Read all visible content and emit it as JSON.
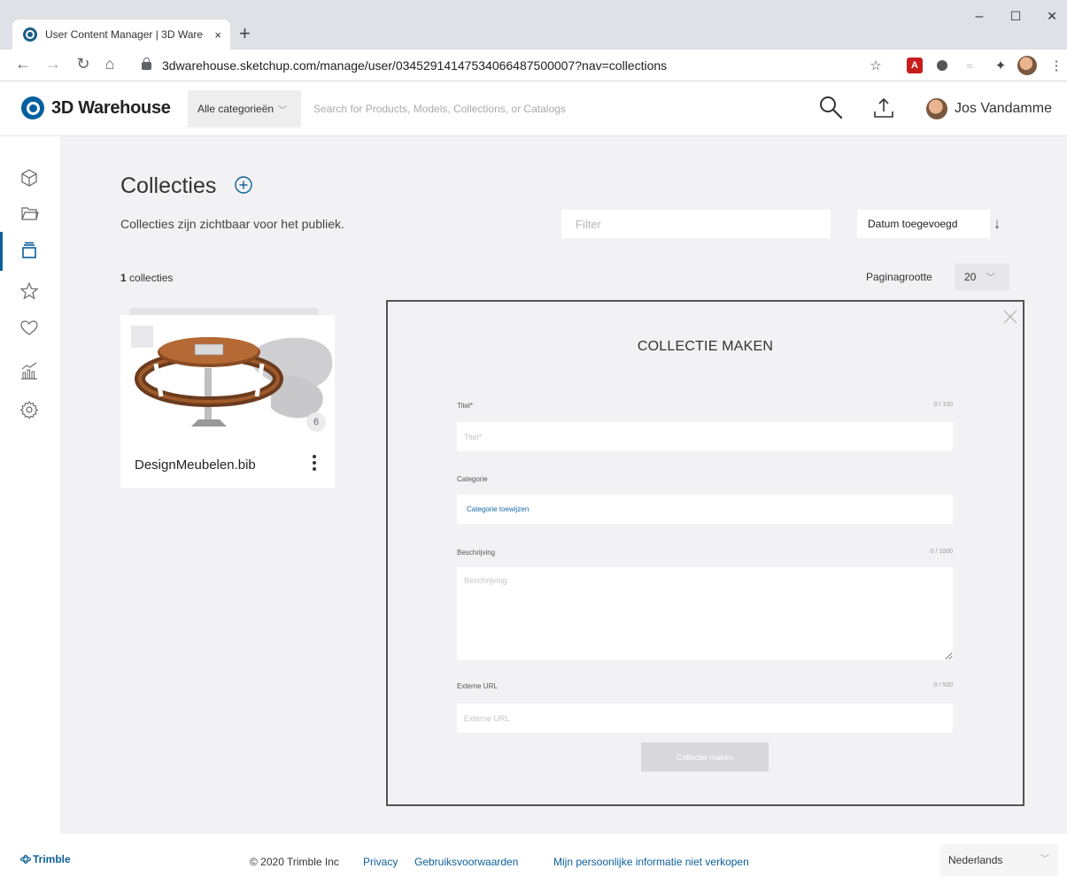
{
  "browser": {
    "tab_title": "User Content Manager | 3D Ware",
    "tab_close": "×",
    "new_tab": "+",
    "url": "3dwarehouse.sketchup.com/manage/user/03452914147534066487500007?nav=collections",
    "back_glyph": "←",
    "forward_glyph": "→",
    "reload_glyph": "↻",
    "home_glyph": "⌂",
    "bookmark_glyph": "☆",
    "pdf_ext_label": "A",
    "puzzle_glyph": "✦",
    "menu_glyph": "⋮",
    "minimize_glyph": "–",
    "maximize_glyph": "☐",
    "close_glyph": "✕"
  },
  "header": {
    "brand": "3D Warehouse",
    "category_select": "Alle categorieën",
    "search_placeholder": "Search for Products, Models, Collections, or Catalogs",
    "user_name": "Jos Vandamme"
  },
  "sidebar": {
    "items": [
      "models-icon",
      "folder-icon",
      "collections-icon",
      "star-icon",
      "heart-icon",
      "analytics-icon",
      "settings-icon"
    ],
    "active_item": "collections-icon"
  },
  "page": {
    "title": "Collecties",
    "subtitle": "Collecties zijn zichtbaar voor het publiek.",
    "filter_placeholder": "Filter",
    "sort_label": "Datum toegevoegd",
    "sort_arrow": "↓",
    "count_number": "1",
    "count_label": "collecties",
    "page_size_label": "Paginagrootte",
    "page_size_value": "20"
  },
  "collection_card": {
    "title": "DesignMeubelen.bib",
    "item_count": "6"
  },
  "modal": {
    "title": "COLLECTIE MAKEN",
    "title_label": "Titel*",
    "title_count": "0 / 100",
    "title_placeholder": "Titel*",
    "category_label": "Categorie",
    "category_value": "Categorie toewijzen",
    "description_label": "Beschrijving",
    "description_count": "0 / 1000",
    "description_placeholder": "Beschrijving",
    "url_label": "Externe URL",
    "url_count": "0 / 500",
    "url_placeholder": "Externe URL",
    "submit_label": "Collectie maken"
  },
  "footer": {
    "brand": "Trimble",
    "copyright": "© 2020 Trimble Inc",
    "privacy": "Privacy",
    "terms": "Gebruiksvoorwaarden",
    "do_not_sell": "Mijn persoonlijke informatie niet verkopen",
    "language": "Nederlands"
  },
  "colors": {
    "accent": "#0b5f9b",
    "background": "#f2f2f4",
    "link": "#1769a8",
    "disabled_button": "#d8d8db"
  }
}
